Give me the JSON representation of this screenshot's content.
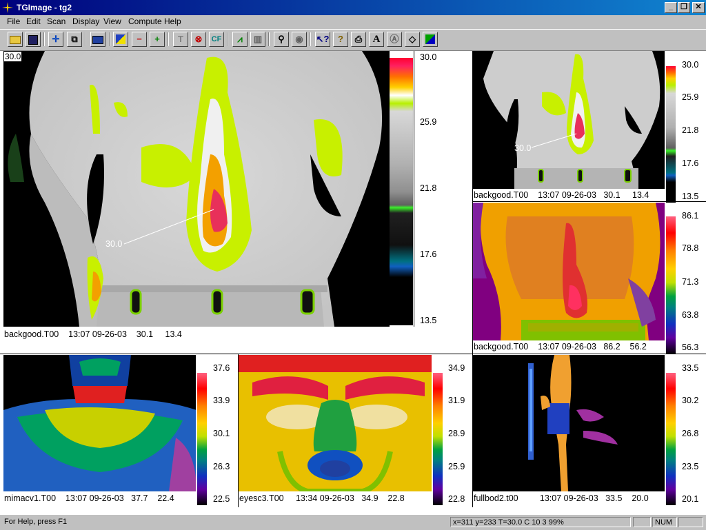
{
  "window": {
    "title": "TGImage - tg2",
    "minimize": "_",
    "restore": "❐",
    "close": "✕"
  },
  "menu": [
    "File",
    "Edit",
    "Scan",
    "Display",
    "View",
    "Compute",
    "Help"
  ],
  "toolbar": [
    {
      "name": "open",
      "glyph": "📂"
    },
    {
      "name": "save",
      "glyph": "💾"
    },
    {
      "name": "crosshair",
      "glyph": "+"
    },
    {
      "name": "copy",
      "glyph": "⧉"
    },
    {
      "name": "camera",
      "glyph": "▣"
    },
    {
      "name": "palette",
      "glyph": "◩"
    },
    {
      "name": "minus",
      "glyph": "−"
    },
    {
      "name": "plus",
      "glyph": "+"
    },
    {
      "name": "text-t",
      "glyph": "T"
    },
    {
      "name": "temperature",
      "glyph": "◎"
    },
    {
      "name": "cf",
      "glyph": "CF"
    },
    {
      "name": "histogram",
      "glyph": "▲"
    },
    {
      "name": "lock",
      "glyph": "▥"
    },
    {
      "name": "zoom",
      "glyph": "🔍"
    },
    {
      "name": "zoom-reset",
      "glyph": "◉"
    },
    {
      "name": "context-help",
      "glyph": "?"
    },
    {
      "name": "help",
      "glyph": "?"
    },
    {
      "name": "print",
      "glyph": "⎙"
    },
    {
      "name": "annotate",
      "glyph": "A"
    },
    {
      "name": "circle-a",
      "glyph": "Ⓐ"
    },
    {
      "name": "eraser",
      "glyph": "◇"
    },
    {
      "name": "color",
      "glyph": "■"
    }
  ],
  "main_image": {
    "corner_value": "30.0",
    "marker_label": "30.0",
    "caption": "backgood.T00    13:07 09-26-03    30.1     13.4",
    "scale_ticks": [
      "30.0",
      "25.9",
      "21.8",
      "17.6",
      "13.5"
    ]
  },
  "thumbs": [
    {
      "id": "back-small",
      "caption": "backgood.T00    13:07 09-26-03   30.1     13.4",
      "marker_label": "30.0",
      "scale_ticks": [
        "30.0",
        "25.9",
        "21.8",
        "17.6",
        "13.5"
      ]
    },
    {
      "id": "back-color",
      "caption": "backgood.T00    13:07 09-26-03   86.2    56.2",
      "scale_ticks": [
        "86.1",
        "78.8",
        "71.3",
        "63.8",
        "56.3"
      ]
    },
    {
      "id": "neck",
      "caption": "mimacv1.T00    13:07 09-26-03   37.7    22.4",
      "scale_ticks": [
        "37.6",
        "33.9",
        "30.1",
        "26.3",
        "22.5"
      ]
    },
    {
      "id": "face",
      "caption": "eyesc3.T00     13:34 09-26-03   34.9    22.8",
      "scale_ticks": [
        "34.9",
        "31.9",
        "28.9",
        "25.9",
        "22.8"
      ]
    },
    {
      "id": "fullbody",
      "caption": "fullbod2.t00         13:07 09-26-03   33.5    20.0",
      "scale_ticks": [
        "33.5",
        "30.2",
        "26.8",
        "23.5",
        "20.1"
      ]
    }
  ],
  "status": {
    "help": "For Help, press F1",
    "coords": "x=311 y=233  T=30.0 C 10 3 99%",
    "num": "NUM"
  }
}
